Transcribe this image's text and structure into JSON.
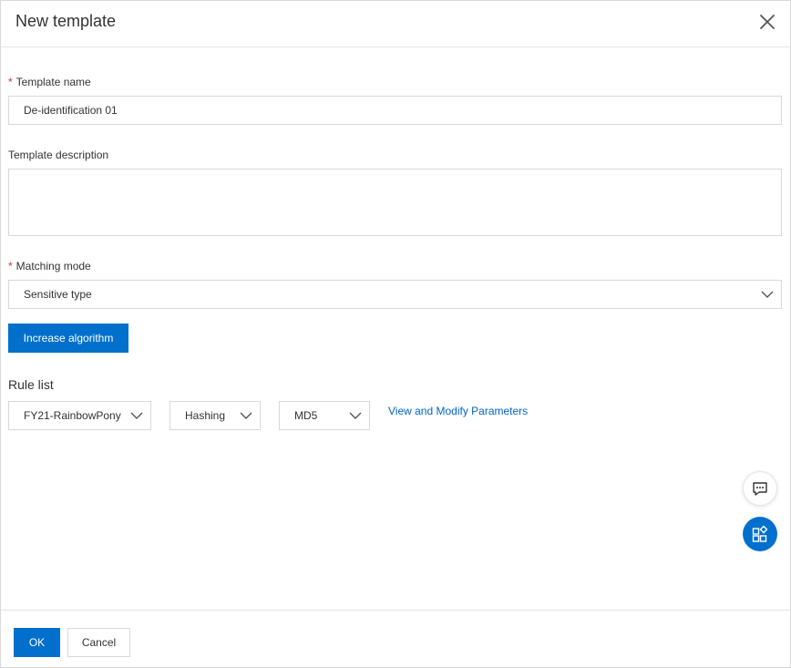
{
  "dialog": {
    "title": "New template"
  },
  "form": {
    "template_name": {
      "required_mark": "*",
      "label": "Template name",
      "value": "De-identification 01"
    },
    "template_description": {
      "label": "Template description",
      "value": ""
    },
    "matching_mode": {
      "required_mark": "*",
      "label": "Matching mode",
      "selected": "Sensitive type"
    },
    "increase_button": "Increase algorithm",
    "rule_list": {
      "title": "Rule list",
      "rule_select": "FY21-RainbowPony",
      "method_select": "Hashing",
      "algorithm_select": "MD5",
      "link": "View and Modify Parameters"
    }
  },
  "footer": {
    "ok": "OK",
    "cancel": "Cancel"
  },
  "colors": {
    "primary": "#0070cc",
    "link": "#0064c8",
    "required": "#d93026",
    "border": "#d9d9d9"
  },
  "icons": {
    "close": "close-icon",
    "caret": "chevron-down-icon",
    "chat": "chat-icon",
    "apps": "apps-icon"
  }
}
